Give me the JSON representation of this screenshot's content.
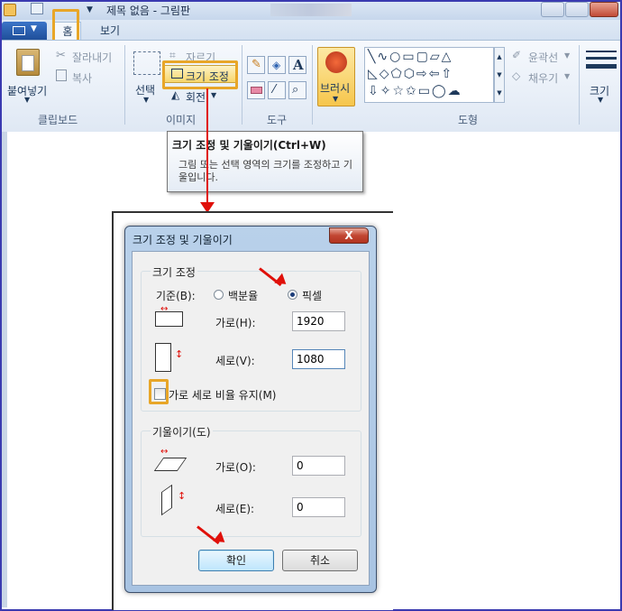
{
  "window": {
    "title": "제목 없음 - 그림판"
  },
  "tabs": {
    "home": "홈",
    "view": "보기"
  },
  "ribbon": {
    "clipboard": {
      "paste": "붙여넣기",
      "cut": "잘라내기",
      "copy": "복사",
      "label": "클립보드"
    },
    "image": {
      "select": "선택",
      "crop": "자르기",
      "resize": "크기 조정",
      "rotate": "회전",
      "label": "이미지"
    },
    "tools": {
      "label": "도구"
    },
    "brushes": {
      "label": "브러시"
    },
    "shapes": {
      "outline": "윤곽선",
      "fill": "채우기",
      "label": "도형"
    },
    "size": {
      "label": "크기"
    }
  },
  "tooltip": {
    "title": "크기 조정 및 기울이기(Ctrl+W)",
    "body": "그림 또는 선택 영역의 크기를 조정하고 기울입니다."
  },
  "dialog": {
    "title": "크기 조정 및 기울이기",
    "close": "X",
    "resize_group": "크기 조정",
    "by_label": "기준(B):",
    "percent": "백분율",
    "pixels": "픽셀",
    "horizontal_label": "가로(H):",
    "horizontal_value": "1920",
    "vertical_label": "세로(V):",
    "vertical_value": "1080",
    "keep_ratio": "가로 세로 비율 유지(M)",
    "skew_group": "기울이기(도)",
    "skew_h_label": "가로(O):",
    "skew_h_value": "0",
    "skew_v_label": "세로(E):",
    "skew_v_value": "0",
    "ok": "확인",
    "cancel": "취소"
  },
  "colors": {
    "highlight": "#e8a628",
    "arrow": "#e0100a"
  }
}
